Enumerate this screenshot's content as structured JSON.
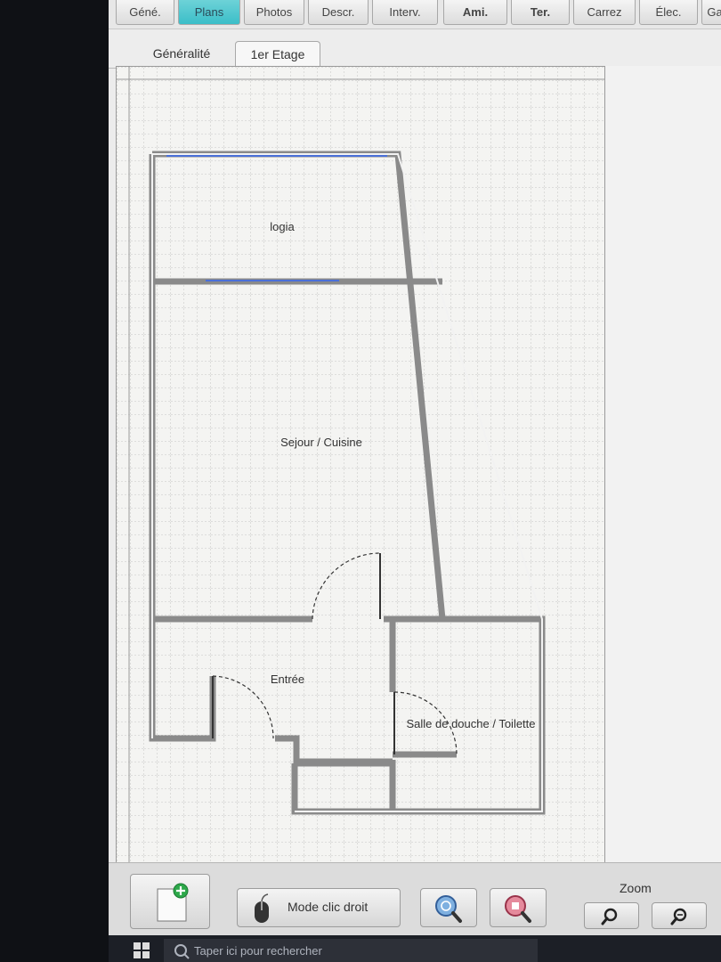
{
  "top_tabs": [
    {
      "label": "Géné.",
      "active": false,
      "bold": false
    },
    {
      "label": "Plans",
      "active": true,
      "bold": false
    },
    {
      "label": "Photos",
      "active": false,
      "bold": false
    },
    {
      "label": "Descr.",
      "active": false,
      "bold": false
    },
    {
      "label": "Interv.",
      "active": false,
      "bold": false
    },
    {
      "label": "Ami.",
      "active": false,
      "bold": true
    },
    {
      "label": "Ter.",
      "active": false,
      "bold": true
    },
    {
      "label": "Carrez",
      "active": false,
      "bold": false
    },
    {
      "label": "Élec.",
      "active": false,
      "bold": false
    },
    {
      "label": "Ga",
      "active": false,
      "bold": false
    }
  ],
  "sub_tabs": {
    "generalite": "Généralité",
    "floor": "1er Etage"
  },
  "plan": {
    "rooms": {
      "logia": "logia",
      "sejour": "Sejour / Cuisine",
      "entree": "Entrée",
      "salle": "Salle de douche / Toilette"
    }
  },
  "toolbar": {
    "mode_label": "Mode clic droit",
    "zoom_label": "Zoom"
  },
  "taskbar": {
    "search_text": "Taper ici pour rechercher"
  },
  "colors": {
    "active_tab": "#3bbec8",
    "wall": "#8a8a8a",
    "window": "#4a6fd8",
    "grid": "#b8b8b8"
  }
}
